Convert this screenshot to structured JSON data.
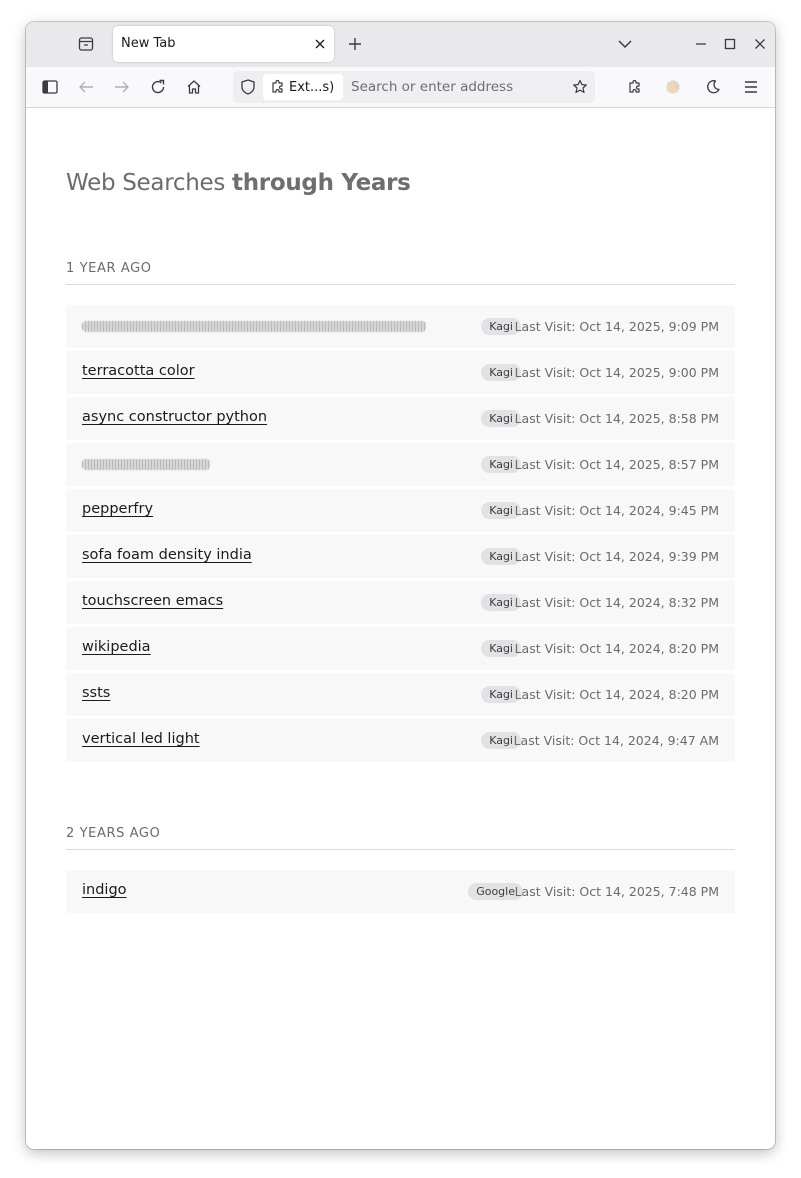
{
  "browser": {
    "tab_title": "New Tab",
    "url_placeholder": "Search or enter address",
    "extension_label": "Ext...s)"
  },
  "page": {
    "title_light": "Web Searches ",
    "title_bold": "through Years"
  },
  "sections": [
    {
      "heading": "1 YEAR AGO",
      "rows": [
        {
          "query": "",
          "redacted": true,
          "engine": "Kagi",
          "visit": "Last Visit: Oct 14, 2025, 9:09 PM"
        },
        {
          "query": "terracotta color",
          "engine": "Kagi",
          "visit": "Last Visit: Oct 14, 2025, 9:00 PM"
        },
        {
          "query": "async constructor python",
          "engine": "Kagi",
          "visit": "Last Visit: Oct 14, 2025, 8:58 PM"
        },
        {
          "query": "",
          "redacted": true,
          "engine": "Kagi",
          "visit": "Last Visit: Oct 14, 2025, 8:57 PM"
        },
        {
          "query": "pepperfry",
          "engine": "Kagi",
          "visit": "Last Visit: Oct 14, 2024, 9:45 PM"
        },
        {
          "query": "sofa foam density india",
          "engine": "Kagi",
          "visit": "Last Visit: Oct 14, 2024, 9:39 PM"
        },
        {
          "query": "touchscreen emacs",
          "engine": "Kagi",
          "visit": "Last Visit: Oct 14, 2024, 8:32 PM"
        },
        {
          "query": "wikipedia",
          "engine": "Kagi",
          "visit": "Last Visit: Oct 14, 2024, 8:20 PM"
        },
        {
          "query": "ssts",
          "engine": "Kagi",
          "visit": "Last Visit: Oct 14, 2024, 8:20 PM"
        },
        {
          "query": "vertical led light",
          "engine": "Kagi",
          "visit": "Last Visit: Oct 14, 2024, 9:47 AM"
        }
      ]
    },
    {
      "heading": "2 YEARS AGO",
      "rows": [
        {
          "query": "indigo",
          "engine": "Google",
          "visit": "Last Visit: Oct 14, 2025, 7:48 PM"
        }
      ]
    }
  ]
}
